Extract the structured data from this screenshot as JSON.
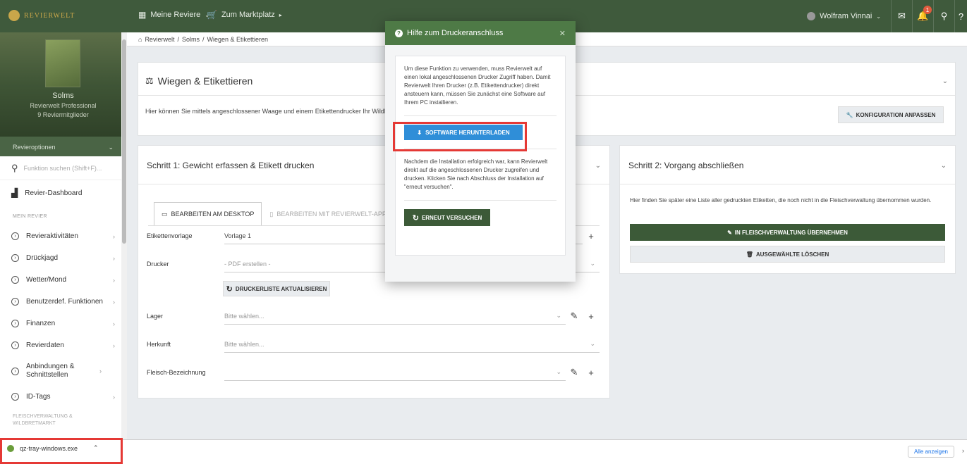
{
  "topbar": {
    "brand": "REVIERWELT",
    "nav_reviere": "Meine Reviere",
    "nav_marktplatz": "Zum Marktplatz",
    "user": "Wolfram Vinnai",
    "notif_count": "1"
  },
  "sidebar": {
    "revier_name": "Solms",
    "plan": "Revierwelt Professional",
    "members": "9 Reviermitglieder",
    "options": "Revieroptionen",
    "search_placeholder": "Funktion suchen (Shift+F)...",
    "dashboard": "Revier-Dashboard",
    "section_mein_revier": "MEIN REVIER",
    "items": [
      {
        "label": "Revieraktivitäten"
      },
      {
        "label": "Drückjagd"
      },
      {
        "label": "Wetter/Mond"
      },
      {
        "label": "Benutzerdef. Funktionen"
      },
      {
        "label": "Finanzen"
      },
      {
        "label": "Revierdaten"
      },
      {
        "label": "Anbindungen & Schnittstellen"
      },
      {
        "label": "ID-Tags"
      }
    ],
    "section_fleisch_1": "FLEISCHVERWALTUNG &",
    "section_fleisch_2": "WILDBRETMARKT"
  },
  "breadcrumb": {
    "items": [
      "Revierwelt",
      "Solms",
      "Wiegen & Etikettieren"
    ],
    "sep": "/"
  },
  "header_card": {
    "title": "Wiegen & Etikettieren",
    "description": "Hier können Sie mittels angeschlossener Waage und einem Etikettendrucker Ihr Wildbre",
    "config_button": "KONFIGURATION ANPASSEN"
  },
  "step1": {
    "title": "Schritt 1: Gewicht erfassen & Etikett drucken",
    "tab_desktop": "BEARBEITEN AM DESKTOP",
    "tab_app": "BEARBEITEN MIT REVIERWELT-APP",
    "label_vorlage": "Etikettenvorlage",
    "val_vorlage": "Vorlage 1",
    "label_drucker": "Drucker",
    "val_drucker": "- PDF erstellen -",
    "btn_refresh": "DRUCKERLISTE AKTUALISIEREN",
    "label_lager": "Lager",
    "val_lager": "Bitte wählen...",
    "label_herkunft": "Herkunft",
    "val_herkunft": "Bitte wählen...",
    "label_fleisch": "Fleisch-Bezeichnung",
    "val_fleisch": ""
  },
  "step2": {
    "title": "Schritt 2: Vorgang abschließen",
    "description": "Hier finden Sie später eine Liste aller gedruckten Etiketten, die noch nicht in die Fleischverwaltung übernommen wurden.",
    "btn_uebernehmen": "IN FLEISCHVERWALTUNG ÜBERNEHMEN",
    "btn_loeschen": "AUSGEWÄHLTE LÖSCHEN"
  },
  "modal": {
    "title": "Hilfe zum Druckeranschluss",
    "text1": "Um diese Funktion zu verwenden, muss Revierwelt auf einen lokal angeschlossenen Drucker Zugriff haben. Damit Revierwelt Ihren Drucker (z.B. Etikettendrucker) direkt ansteuern kann, müssen Sie zunächst eine Software auf Ihrem PC installieren.",
    "btn_download": "SOFTWARE HERUNTERLADEN",
    "text2": "Nachdem die Installation erfolgreich war, kann Revierwelt direkt auf die angeschlossenen Drucker zugreifen und drucken. Klicken Sie nach Abschluss der Installation auf \"erneut versuchen\".",
    "btn_retry": "ERNEUT VERSUCHEN"
  },
  "download_bar": {
    "filename": "qz-tray-windows.exe",
    "show_all": "Alle anzeigen"
  },
  "colors": {
    "brand_green": "#3f5a3c",
    "modal_green": "#4e7a46",
    "download_blue": "#2f8ed8",
    "highlight_red": "#e53935"
  }
}
